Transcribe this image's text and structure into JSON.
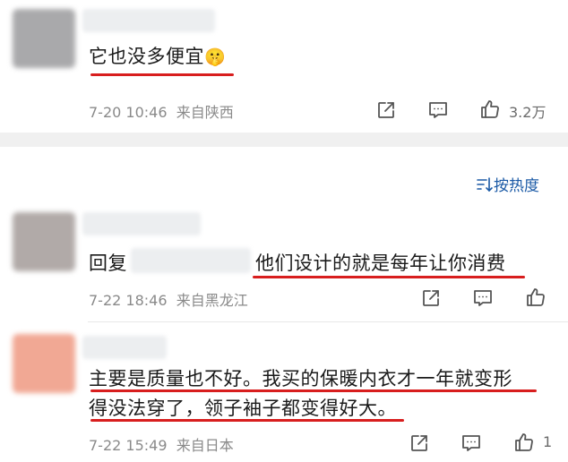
{
  "top_comment": {
    "text": "它也没多便宜",
    "emoji": "🤫",
    "time": "7-20 10:46",
    "location": "来自陕西",
    "like_count": "3.2万"
  },
  "sort": {
    "icon": "sort-icon",
    "label": "按热度"
  },
  "replies": [
    {
      "prefix": "回复",
      "text": "他们设计的就是每年让你消费",
      "time": "7-22 18:46",
      "location": "来自黑龙江",
      "like_count": ""
    },
    {
      "line1": "主要是质量也不好。我买的保暖内衣才一年就变形",
      "line2": "得没法穿了，领子袖子都变得好大。",
      "time": "7-22 15:49",
      "location": "来自日本",
      "like_count": "1"
    }
  ],
  "colors": {
    "underline": "#d81e1e",
    "meta_text": "#8a8a8a",
    "sort_text": "#1b5aa6",
    "divider": "#f0f0f0"
  }
}
